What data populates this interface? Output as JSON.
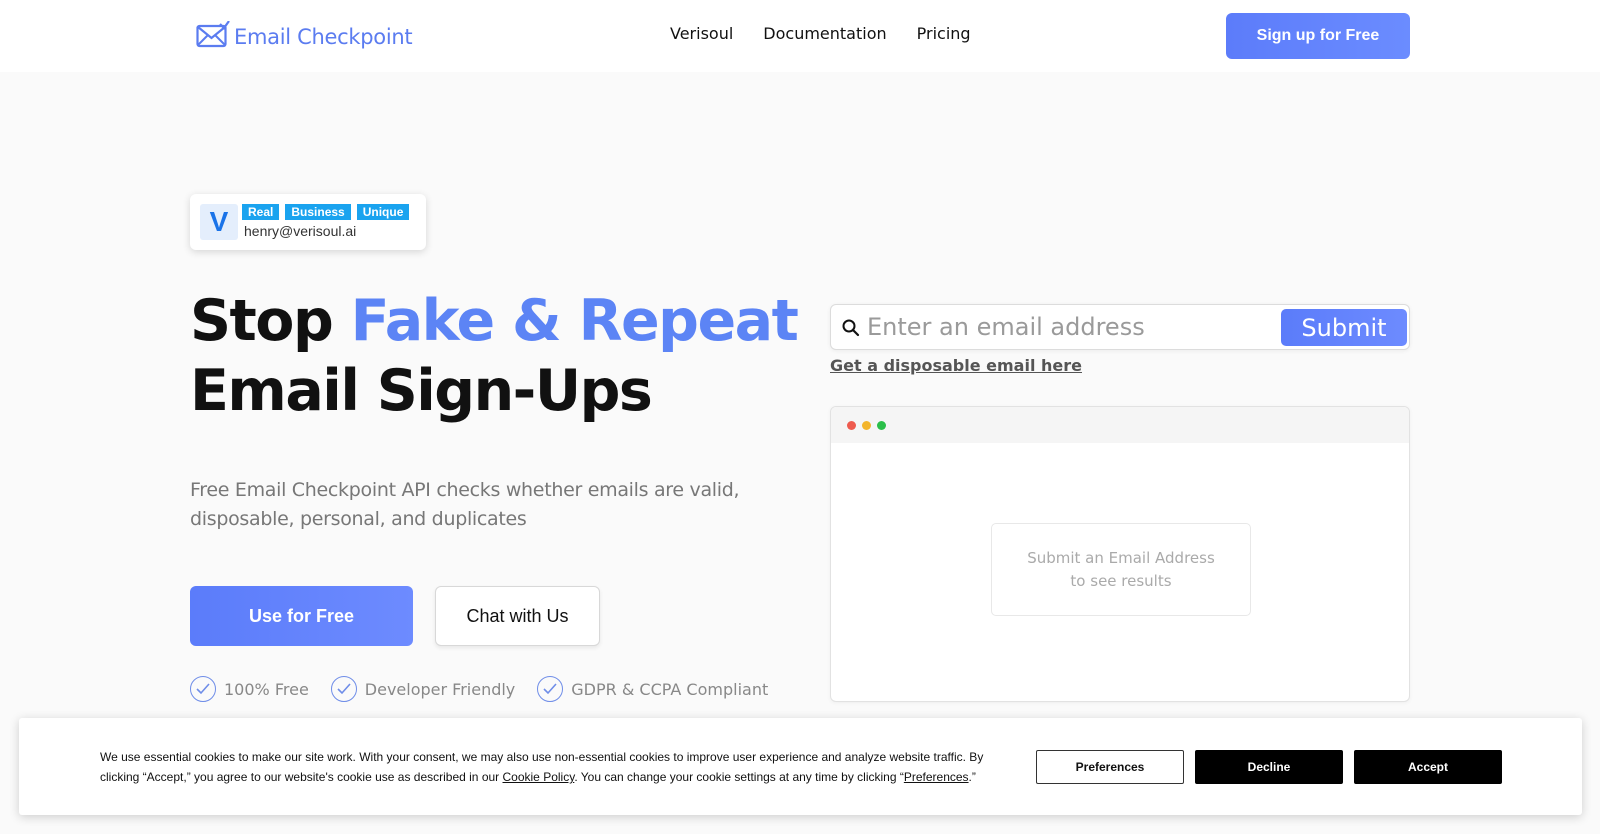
{
  "header": {
    "logo_text": "Email Checkpoint",
    "nav": [
      "Verisoul",
      "Documentation",
      "Pricing"
    ],
    "signup_label": "Sign up for Free"
  },
  "verisoul_card": {
    "logo_letter": "V",
    "badges": [
      "Real",
      "Business",
      "Unique"
    ],
    "email": "henry@verisoul.ai"
  },
  "hero": {
    "title_lead": "Stop ",
    "title_accent": "Fake & Repeat",
    "title_line2": "Email Sign-Ups",
    "subtitle": "Free Email Checkpoint API checks whether emails are valid, disposable, personal, and duplicates",
    "primary_cta": "Use for Free",
    "secondary_cta": "Chat with Us",
    "features": [
      "100% Free",
      "Developer Friendly",
      "GDPR & CCPA Compliant"
    ]
  },
  "checker": {
    "input_placeholder": "Enter an email address",
    "input_value": "",
    "submit_label": "Submit",
    "disposable_link": "Get a disposable email here",
    "result_placeholder_line1": "Submit an Email Address",
    "result_placeholder_line2": "to see results"
  },
  "cookie_banner": {
    "text_part1": "We use essential cookies to make our site work. With your consent, we may also use non-essential cookies to improve user experience and analyze website traffic. By clicking “Accept,” you agree to our website's cookie use as described in our ",
    "cookie_policy_link": "Cookie Policy",
    "text_part2": ". You can change your cookie settings at any time by clicking “",
    "preferences_link": "Preferences",
    "text_part3": ".”",
    "preferences_button": "Preferences",
    "decline_button": "Decline",
    "accept_button": "Accept"
  },
  "colors": {
    "accent": "#5c84f5",
    "button_gradient_start": "#5b7cfa",
    "badge_blue": "#1aa3ef",
    "window_dot_red": "#ee5b4f",
    "window_dot_yellow": "#f3b52c",
    "window_dot_green": "#2bbf4a"
  }
}
